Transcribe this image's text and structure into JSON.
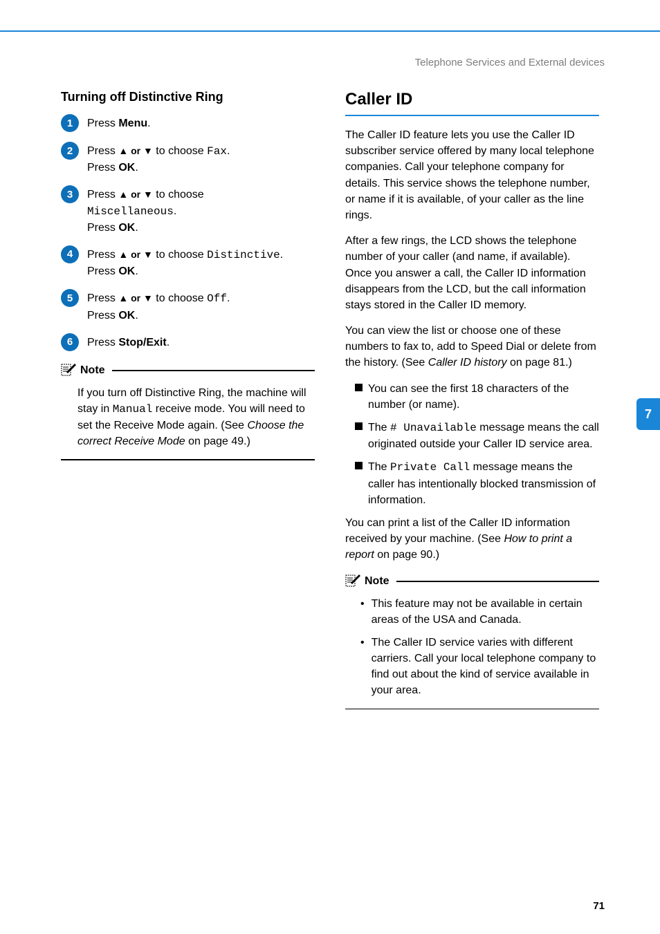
{
  "header": {
    "right_text": "Telephone Services and External devices"
  },
  "left": {
    "heading": "Turning off Distinctive Ring",
    "steps": {
      "s1": {
        "t1": "Press ",
        "b1": "Menu",
        "t2": "."
      },
      "s2": {
        "t1": "Press ",
        "arrows": "▲ or ▼",
        "t2": " to choose ",
        "mono": "Fax",
        "t3": ".",
        "line2a": "Press ",
        "line2b": "OK",
        "line2c": "."
      },
      "s3": {
        "t1": "Press ",
        "arrows": "▲ or ▼",
        "t2": " to choose",
        "mono": "Miscellaneous",
        "t3": ".",
        "line2a": "Press ",
        "line2b": "OK",
        "line2c": "."
      },
      "s4": {
        "t1": "Press ",
        "arrows": "▲ or ▼",
        "t2": " to choose ",
        "mono": "Distinctive",
        "t3": ".",
        "line2a": "Press ",
        "line2b": "OK",
        "line2c": "."
      },
      "s5": {
        "t1": "Press ",
        "arrows": "▲ or ▼",
        "t2": " to choose ",
        "mono": "Off",
        "t3": ".",
        "line2a": "Press ",
        "line2b": "OK",
        "line2c": "."
      },
      "s6": {
        "t1": "Press ",
        "b1": "Stop/Exit",
        "t2": "."
      }
    },
    "note": {
      "label": "Note",
      "body_a": "If you turn off Distinctive Ring, the machine will stay in ",
      "body_mono": "Manual",
      "body_b": " receive mode. You will need to set the Receive Mode again. (See ",
      "body_italic": "Choose the correct Receive Mode",
      "body_c": " on page 49.)"
    }
  },
  "right": {
    "heading": "Caller ID",
    "p1": "The Caller ID feature lets you use the Caller ID subscriber service offered by many local telephone companies. Call your telephone company for details. This service shows the telephone number, or name if it is available, of your caller as the line rings.",
    "p2": "After a few rings, the LCD shows the telephone number of your caller (and name, if available). Once you answer a call, the Caller ID information disappears from the LCD, but the call information stays stored in the Caller ID memory.",
    "p3_a": "You can view the list or choose one of these numbers to fax to, add to Speed Dial or delete from the history. (See ",
    "p3_italic": "Caller ID history",
    "p3_b": " on page 81.)",
    "b1": "You can see the first 18 characters of the number (or name).",
    "b2_a": "The ",
    "b2_mono": "# Unavailable",
    "b2_b": " message means the call originated outside your Caller ID service area.",
    "b3_a": "The ",
    "b3_mono": "Private Call",
    "b3_b": " message means the caller has intentionally blocked transmission of information.",
    "p4_a": "You can print a list of the Caller ID information received by your machine. (See ",
    "p4_italic": "How to print a report",
    "p4_b": " on page 90.)",
    "note": {
      "label": "Note",
      "d1": "This feature may not be available in certain areas of the USA and Canada.",
      "d2": "The Caller ID service varies with different carriers. Call your local telephone company to find out about the kind of service available in your area."
    }
  },
  "side_tab": "7",
  "page_number": "71"
}
